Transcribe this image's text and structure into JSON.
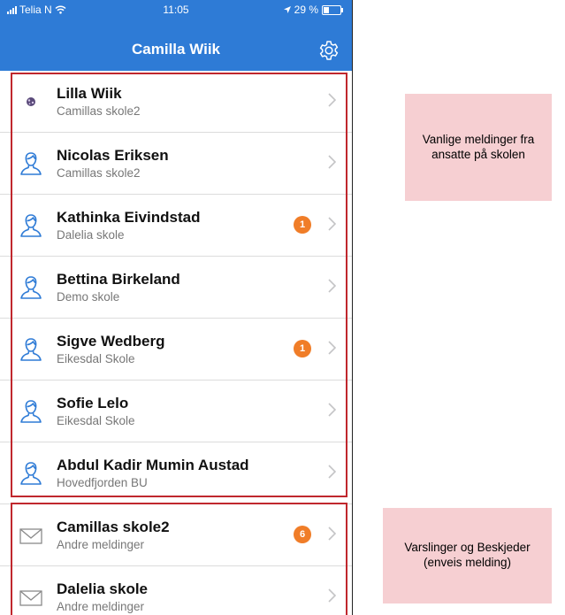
{
  "status_bar": {
    "carrier": "Telia N",
    "time": "11:05",
    "battery": "29 %",
    "battery_level": 0.29
  },
  "nav": {
    "title": "Camilla Wiik",
    "settings_icon": "gear-icon"
  },
  "contacts": [
    {
      "name": "Lilla Wiik",
      "school": "Camillas skole2",
      "icon": "avatar-icon",
      "badge": ""
    },
    {
      "name": "Nicolas Eriksen",
      "school": "Camillas skole2",
      "icon": "person-icon",
      "badge": ""
    },
    {
      "name": "Kathinka Eivindstad",
      "school": "Dalelia skole",
      "icon": "person-icon",
      "badge": "1"
    },
    {
      "name": "Bettina Birkeland",
      "school": "Demo skole",
      "icon": "person-icon",
      "badge": ""
    },
    {
      "name": "Sigve Wedberg",
      "school": "Eikesdal Skole",
      "icon": "person-icon",
      "badge": "1"
    },
    {
      "name": "Sofie Lelo",
      "school": "Eikesdal Skole",
      "icon": "person-icon",
      "badge": ""
    },
    {
      "name": "Abdul Kadir Mumin Austad",
      "school": "Hovedfjorden BU",
      "icon": "person-icon",
      "badge": ""
    }
  ],
  "notices": [
    {
      "name": "Camillas skole2",
      "sub": "Andre meldinger",
      "icon": "envelope-icon",
      "badge": "6"
    },
    {
      "name": "Dalelia skole",
      "sub": "Andre meldinger",
      "icon": "envelope-icon",
      "badge": ""
    }
  ],
  "annotations": {
    "staff_note": [
      "Vanlige meldinger fra",
      "ansatte på skolen"
    ],
    "notice_note": [
      "Varslinger og Beskjeder",
      "(enveis melding)"
    ]
  },
  "colors": {
    "brand": "#2e7bd6",
    "badge": "#f07d28",
    "highlight": "#c0272d",
    "note_bg": "#f6cfd2"
  }
}
